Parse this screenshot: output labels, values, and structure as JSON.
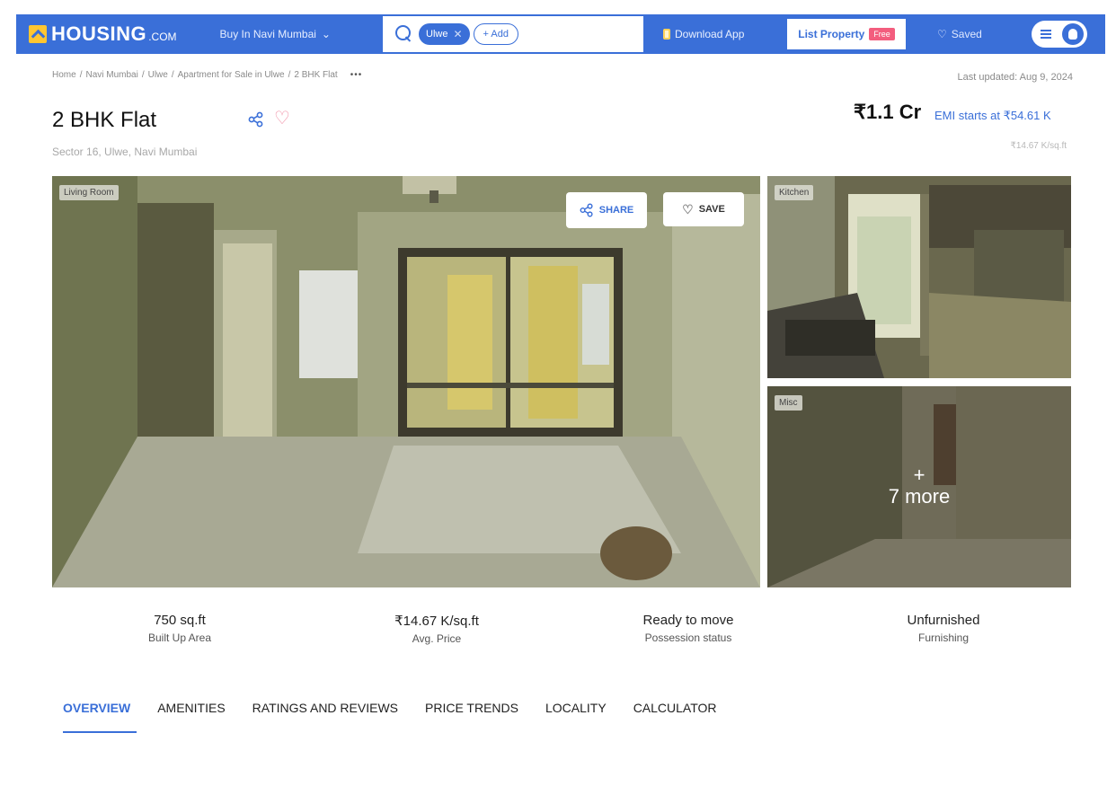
{
  "header": {
    "logo_text": "HOUSING",
    "logo_suffix": ".COM",
    "city_select": "Buy In Navi Mumbai",
    "search_chip": "Ulwe",
    "add_label": "+ Add",
    "download_app": "Download App",
    "list_property": "List Property",
    "free_badge": "Free",
    "saved": "Saved",
    "accent_color": "#3a6fd8"
  },
  "breadcrumb": {
    "items": [
      "Home",
      "Navi Mumbai",
      "Ulwe",
      "Apartment for Sale in Ulwe",
      "2 BHK Flat"
    ],
    "separator": "/",
    "more": "•••"
  },
  "last_updated": "Last updated: Aug 9, 2024",
  "listing": {
    "title": "2 BHK Flat",
    "locality": "Sector 16, Ulwe, Navi Mumbai",
    "price": "₹1.1 Cr",
    "emi": "EMI starts at ₹54.61 K",
    "price_per_sqft": "₹14.67 K/sq.ft"
  },
  "gallery": {
    "main_tag": "Living Room",
    "share_label": "SHARE",
    "save_label": "SAVE",
    "kitchen_tag": "Kitchen",
    "misc_tag": "Misc",
    "more_plus": "+",
    "more_label": "7 more"
  },
  "stats": [
    {
      "value": "750 sq.ft",
      "label": "Built Up Area"
    },
    {
      "value": "₹14.67 K/sq.ft",
      "label": "Avg. Price"
    },
    {
      "value": "Ready to move",
      "label": "Possession status"
    },
    {
      "value": "Unfurnished",
      "label": "Furnishing"
    }
  ],
  "tabs": [
    {
      "label": "OVERVIEW",
      "active": true
    },
    {
      "label": "AMENITIES",
      "active": false
    },
    {
      "label": "RATINGS AND REVIEWS",
      "active": false
    },
    {
      "label": "PRICE TRENDS",
      "active": false
    },
    {
      "label": "LOCALITY",
      "active": false
    },
    {
      "label": "CALCULATOR",
      "active": false
    }
  ]
}
